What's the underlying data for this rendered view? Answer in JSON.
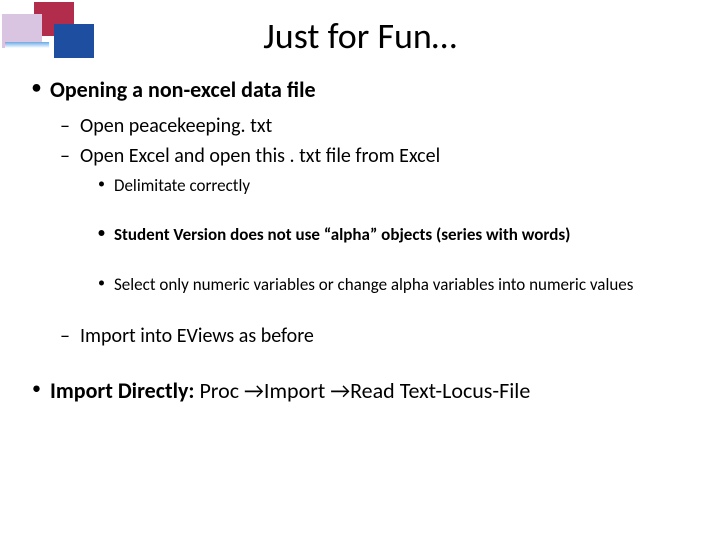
{
  "title": "Just for Fun…",
  "bullets": {
    "main1": "Opening a non-excel data file",
    "sub1": "Open peacekeeping. txt",
    "sub2": "Open Excel and open this . txt file from Excel",
    "sub2a": "Delimitate correctly",
    "sub2b": "Student Version does not use “alpha” objects (series with words)",
    "sub2c": "Select only numeric variables or change alpha variables into numeric values",
    "sub3": "Import into EViews as before",
    "main2_label": "Import Directly: ",
    "main2_rest": "Proc →Import →Read Text-Locus-File"
  }
}
